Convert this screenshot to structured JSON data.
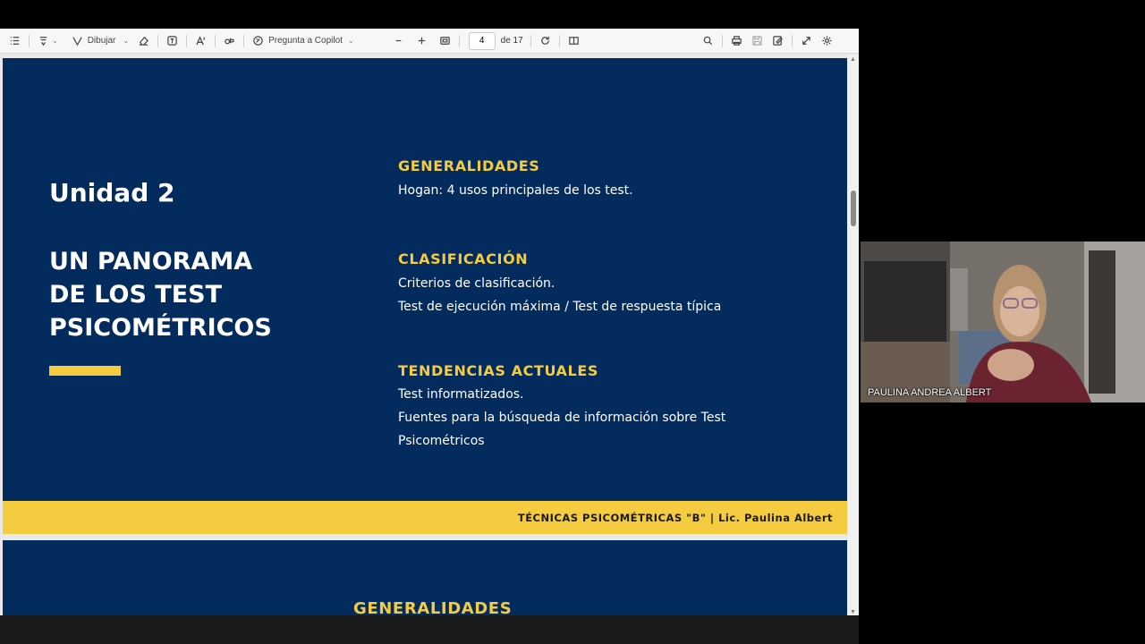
{
  "toolbar": {
    "draw_label": "Dibujar",
    "copilot_label": "Pregunta a Copilot",
    "page_current": "4",
    "page_of": "de 17"
  },
  "slide1": {
    "unit": "Unidad 2",
    "title_lines": [
      "UN PANORAMA",
      "DE LOS TEST",
      "PSICOMÉTRICOS"
    ],
    "sections": [
      {
        "heading": "GENERALIDADES",
        "lines": [
          "Hogan: 4 usos principales de los test."
        ]
      },
      {
        "heading": "CLASIFICACIÓN",
        "lines": [
          "Criterios de clasificación.",
          "Test de ejecución máxima / Test de respuesta típica"
        ]
      },
      {
        "heading": "TENDENCIAS ACTUALES",
        "lines": [
          "Test informatizados.",
          "Fuentes para la búsqueda de información sobre Test",
          "Psicométricos"
        ]
      }
    ],
    "footer": "TÉCNICAS PSICOMÉTRICAS \"B\" | Lic. Paulina Albert"
  },
  "slide2": {
    "heading": "GENERALIDADES"
  },
  "webcam": {
    "participant_name": "PAULINA ANDREA ALBERT"
  },
  "colors": {
    "slide_background": "#042b5e",
    "accent_yellow": "#f5cc3f"
  },
  "icons": [
    "table-of-contents-icon",
    "highlight-icon",
    "draw-icon",
    "eraser-icon",
    "text-box-icon",
    "text-format-icon",
    "read-aloud-icon",
    "copilot-icon",
    "zoom-out-icon",
    "zoom-in-icon",
    "fit-page-icon",
    "rotate-icon",
    "page-view-icon",
    "search-icon",
    "print-icon",
    "save-icon",
    "save-as-icon",
    "fullscreen-icon",
    "settings-icon"
  ]
}
